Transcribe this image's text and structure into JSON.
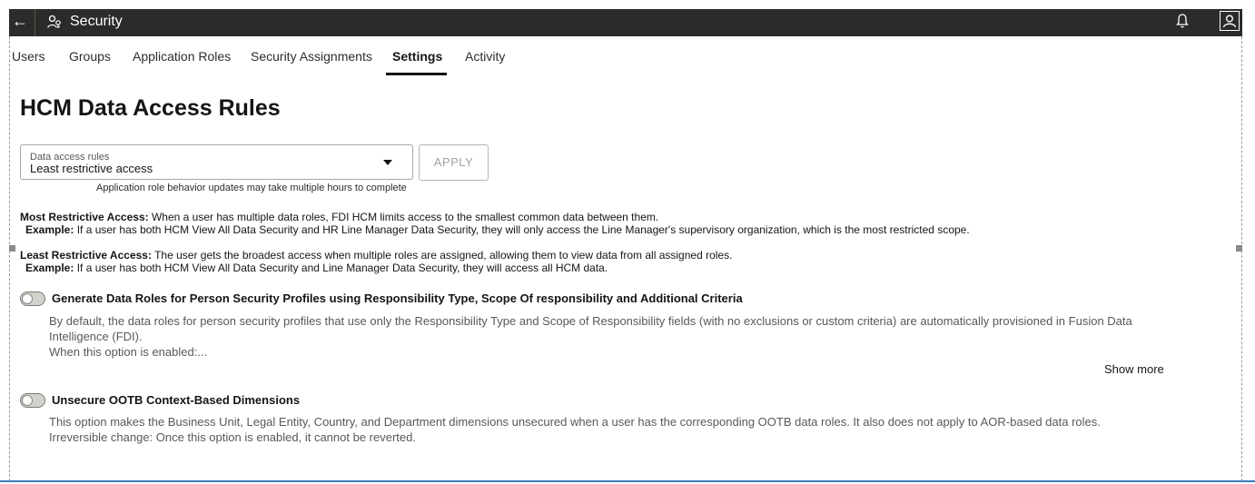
{
  "header": {
    "title": "Security",
    "icons": [
      "back-arrow-icon",
      "user-security-icon",
      "bell-icon",
      "user-avatar-icon"
    ]
  },
  "tabs": [
    {
      "label": "Users"
    },
    {
      "label": "Groups"
    },
    {
      "label": "Application Roles"
    },
    {
      "label": "Security Assignments"
    },
    {
      "label": "Settings",
      "active": true
    },
    {
      "label": "Activity"
    }
  ],
  "page": {
    "title": "HCM Data Access Rules"
  },
  "data_access": {
    "label": "Data access rules",
    "value": "Least restrictive access",
    "apply_label": "APPLY",
    "hint": "Application role behavior updates may take multiple hours to complete"
  },
  "descriptions": {
    "most": {
      "heading": "Most Restrictive Access:",
      "text": "When a user has multiple data roles, FDI HCM limits access to the smallest common data between them.",
      "example_label": "Example:",
      "example": "If a user has both HCM View All Data Security and HR Line Manager Data Security, they will only access the Line Manager's supervisory organization, which is the most restricted scope."
    },
    "least": {
      "heading": "Least Restrictive Access:",
      "text": "The user gets the broadest access when multiple roles are assigned, allowing them to view data from all assigned roles.",
      "example_label": "Example:",
      "example": "If a user has both HCM View All Data Security and Line Manager Data Security, they will access all HCM data."
    }
  },
  "options": [
    {
      "title": "Generate Data Roles for Person Security Profiles using Responsibility Type, Scope Of responsibility and Additional Criteria",
      "desc_line1": "By default, the data roles for person security profiles that use only the Responsibility Type and Scope of Responsibility fields (with no exclusions or custom criteria) are automatically provisioned in Fusion Data Intelligence (FDI).",
      "desc_line2": "When this option is enabled:...",
      "enabled": false
    },
    {
      "title": "Unsecure OOTB Context-Based Dimensions",
      "desc_line1": "This option makes the Business Unit, Legal Entity, Country, and Department dimensions unsecured when a user has the corresponding OOTB data roles. It also does not apply to AOR-based data roles.",
      "desc_line2": "Irreversible change: Once this option is enabled, it cannot be reverted.",
      "enabled": false
    }
  ],
  "show_more_label": "Show more",
  "colors": {
    "header_bg": "#2c2b29",
    "accent_line": "#3a7bc0"
  }
}
